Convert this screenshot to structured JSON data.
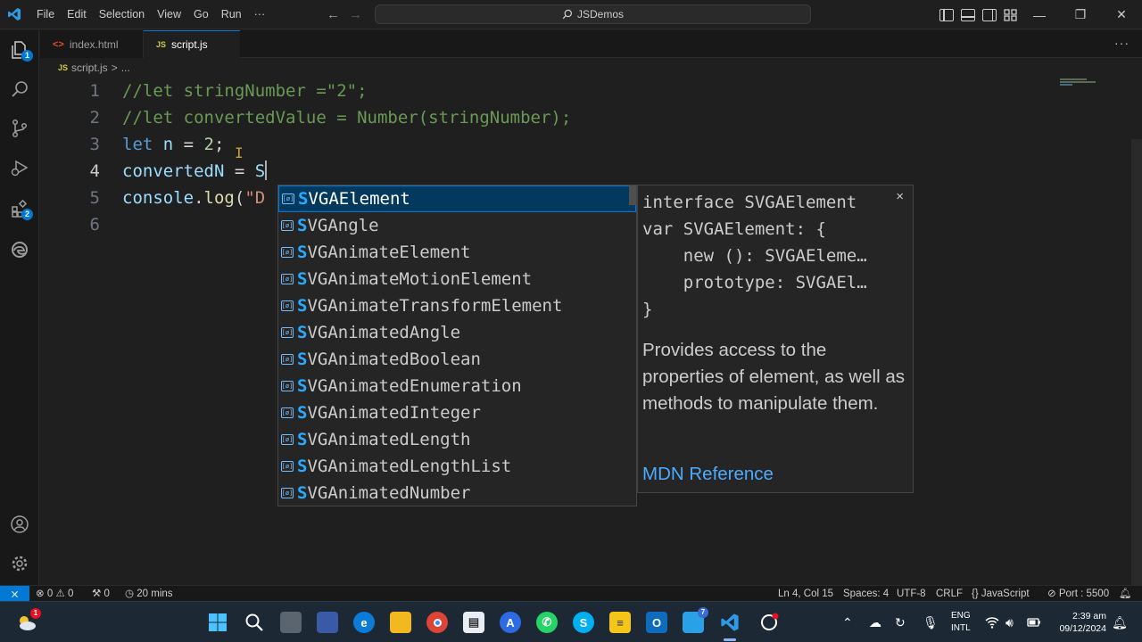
{
  "window": {
    "menu": [
      "File",
      "Edit",
      "Selection",
      "View",
      "Go",
      "Run"
    ],
    "menu_more": "···",
    "search_text": "JSDemos",
    "controls": {
      "minimize": "—",
      "restore": "❐",
      "close": "✕"
    }
  },
  "activity": {
    "explorer_badge": "1",
    "extensions_badge": "2"
  },
  "tabs": [
    {
      "label": "index.html",
      "glyph": "<>"
    },
    {
      "label": "script.js",
      "glyph": "JS",
      "dirty": true
    }
  ],
  "tab_more": "···",
  "breadcrumb": {
    "file": "script.js",
    "sep": ">",
    "more": "..."
  },
  "editor": {
    "line_numbers": [
      "1",
      "2",
      "3",
      "4",
      "5",
      "6"
    ],
    "lines": {
      "l1": "//let stringNumber =\"2\";",
      "l2": "//let convertedValue = Number(stringNumber);",
      "l3_kw": "let",
      "l3_var": " n",
      "l3_op": " = ",
      "l3_num": "2",
      "l3_end": ";",
      "l4_var": "convertedN",
      "l4_op": " = ",
      "l4_typed": "S",
      "l5_obj": "console",
      "l5_dot": ".",
      "l5_fn": "log",
      "l5_paren": "(",
      "l5_str": "\"D"
    }
  },
  "suggestions": {
    "match": "S",
    "items": [
      "VGAElement",
      "VGAngle",
      "VGAnimateElement",
      "VGAnimateMotionElement",
      "VGAnimateTransformElement",
      "VGAnimatedAngle",
      "VGAnimatedBoolean",
      "VGAnimatedEnumeration",
      "VGAnimatedInteger",
      "VGAnimatedLength",
      "VGAnimatedLengthList",
      "VGAnimatedNumber"
    ],
    "selected_index": 0
  },
  "details": {
    "signature": "interface SVGAElement\nvar SVGAElement: {\n    new (): SVGAEleme…\n    prototype: SVGAEl…\n}",
    "doc": "Provides access to the properties of element, as well as methods to manipulate them.",
    "link": "MDN Reference",
    "close": "×"
  },
  "status": {
    "errors": "0",
    "warnings": "0",
    "ports": "0",
    "time": "20 mins",
    "position": "Ln 4, Col 15",
    "spaces": "Spaces: 4",
    "encoding": "UTF-8",
    "eol": "CRLF",
    "language": "JavaScript",
    "port": "Port : 5500"
  },
  "taskbar": {
    "weather_badge": "1",
    "teams_badge": "7",
    "lang_top": "ENG",
    "lang_bottom": "INTL",
    "time": "2:39 am",
    "date": "09/12/2024"
  },
  "colors": {
    "accent": "#0078d4",
    "comment": "#6a9955",
    "keyword": "#569cd6",
    "match": "#2aaaff",
    "link": "#4daafc"
  }
}
